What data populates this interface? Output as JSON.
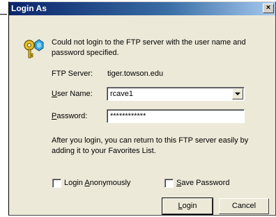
{
  "window": {
    "title": "Login As",
    "close_glyph": "×"
  },
  "icon": {
    "name": "key-icon"
  },
  "message": "Could not login to the FTP server with the user name and password specified.",
  "server": {
    "label": "FTP Server:",
    "value": "tiger.towson.edu"
  },
  "username": {
    "label_accel": "U",
    "label_rest": "ser Name:",
    "value": "rcave1"
  },
  "password": {
    "label_accel": "P",
    "label_rest": "assword:",
    "value": "************"
  },
  "info": "After you login, you can return to this FTP server easily by adding it to your Favorites List.",
  "anonymous": {
    "label_before": "Login ",
    "label_accel": "A",
    "label_after": "nonymously",
    "checked": false
  },
  "save_password": {
    "label_accel": "S",
    "label_rest": "ave Password",
    "checked": false
  },
  "buttons": {
    "login": {
      "accel": "L",
      "rest": "ogin"
    },
    "cancel": {
      "label": "Cancel"
    }
  }
}
